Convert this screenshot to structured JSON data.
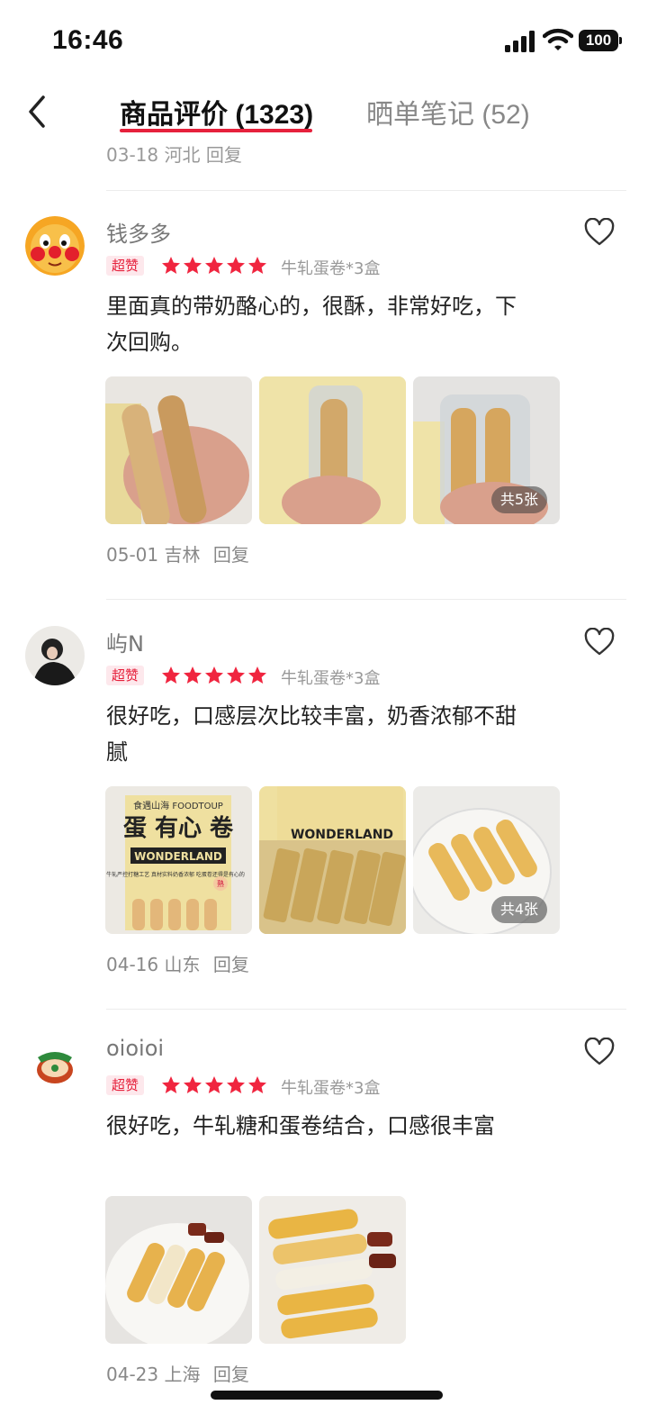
{
  "status_bar": {
    "time": "16:46",
    "battery": "100"
  },
  "nav": {
    "tabs": [
      {
        "label": "商品评价 (1323)"
      },
      {
        "label": "晒单笔记 (52)"
      }
    ]
  },
  "previous_review": {
    "meta": "03-18 河北 回复"
  },
  "reviews": [
    {
      "username": "钱多多",
      "badge": "超赞",
      "rating": 5,
      "variant": "牛轧蛋卷*3盒",
      "text": "里面真的带奶酪心的，很酥，非常好吃，下次回购。",
      "photo_count_label": "共5张",
      "date": "05-01",
      "location": "吉林",
      "reply": "回复"
    },
    {
      "username": "屿N",
      "badge": "超赞",
      "rating": 5,
      "variant": "牛轧蛋卷*3盒",
      "text": "很好吃，口感层次比较丰富，奶香浓郁不甜腻",
      "photo_count_label": "共4张",
      "photo_texts": [
        "食遇山海 FOODTOUP",
        "蛋 有心 卷",
        "WONDERLAND",
        "牛轧严控打糖工艺 真材实料奶香浓郁 吃蛋卷还得是有心的",
        "熟"
      ],
      "date": "04-16",
      "location": "山东",
      "reply": "回复"
    },
    {
      "username": "oioioi",
      "badge": "超赞",
      "rating": 5,
      "variant": "牛轧蛋卷*3盒",
      "text": "很好吃，牛轧糖和蛋卷结合，口感很丰富",
      "date": "04-23",
      "location": "上海",
      "reply": "回复"
    }
  ],
  "colors": {
    "accent": "#e6213c",
    "star": "#f0253f",
    "badge_bg": "#fde8ec"
  },
  "icons": {
    "back": "chevron-left-icon",
    "like": "heart-outline-icon",
    "star": "star-icon"
  }
}
